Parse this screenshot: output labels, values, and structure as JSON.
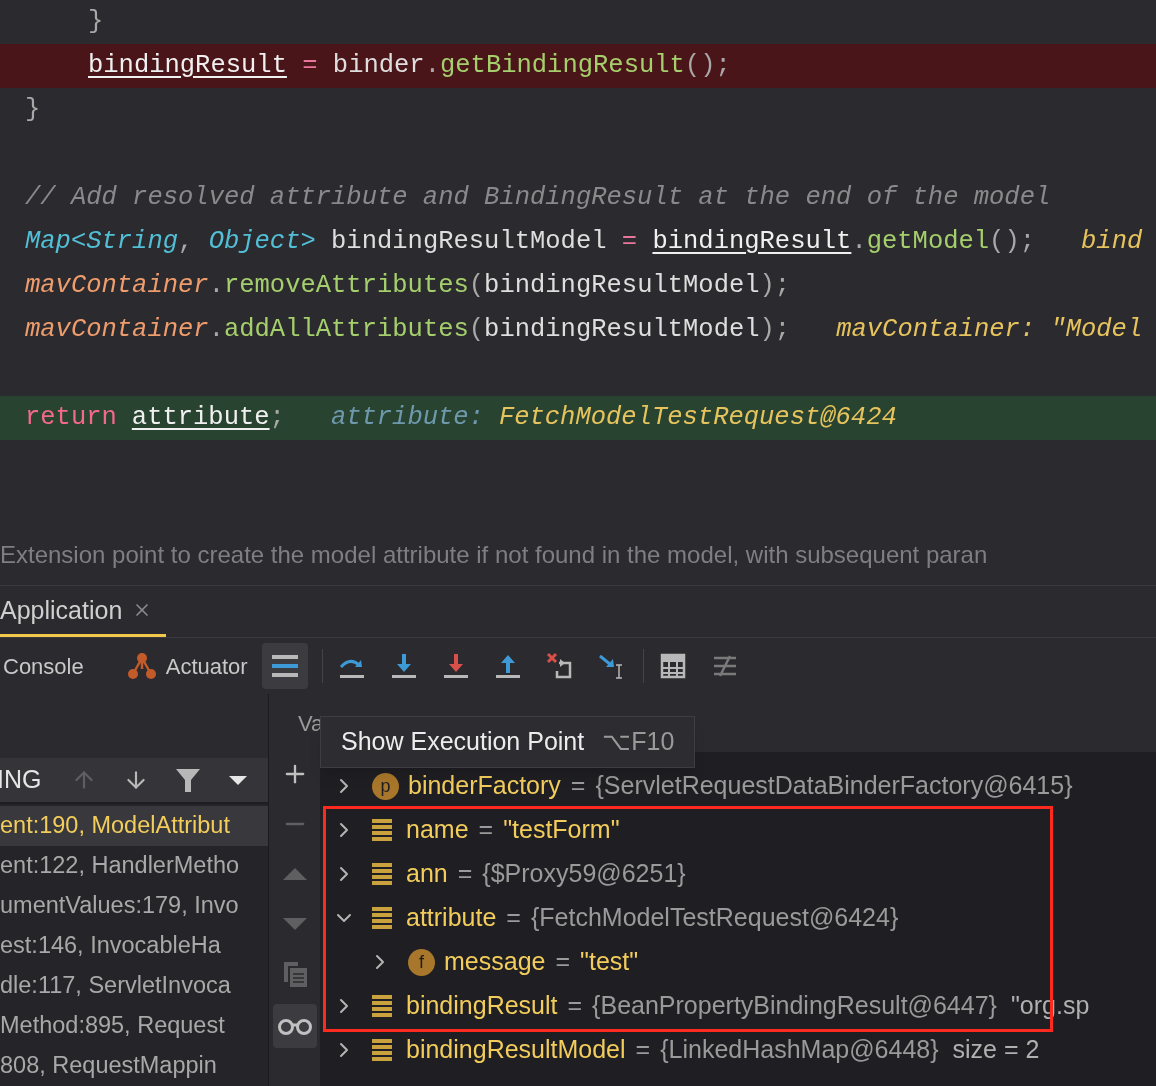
{
  "editor": {
    "lines": [
      {
        "kind": "block",
        "children": [
          {
            "kind": "plain",
            "tokens": [
              {
                "text": "}",
                "kind": "punct"
              }
            ]
          },
          {
            "kind": "error",
            "tokens": [
              {
                "text": "bindingResult",
                "kind": "var"
              },
              {
                "text": " = ",
                "kind": "op"
              },
              {
                "text": "binder",
                "kind": "plain"
              },
              {
                "text": ".",
                "kind": "punct"
              },
              {
                "text": "getBindingResult",
                "kind": "method"
              },
              {
                "text": "();",
                "kind": "punct"
              }
            ]
          }
        ]
      },
      {
        "kind": "plain",
        "tokens": [
          {
            "text": "}",
            "kind": "punct"
          }
        ]
      },
      {
        "kind": "plain"
      },
      {
        "kind": "plain",
        "tokens": [
          {
            "text": "// Add resolved attribute and BindingResult at the end of the model",
            "kind": "comment"
          }
        ]
      },
      {
        "kind": "plain",
        "tokens": [
          {
            "text": "Map<String",
            "kind": "type"
          },
          {
            "text": ", ",
            "kind": "punct"
          },
          {
            "text": "Object>",
            "kind": "type"
          },
          {
            "text": " bindingResultModel ",
            "kind": "plain"
          },
          {
            "text": "= ",
            "kind": "op"
          },
          {
            "text": "bindingResult",
            "kind": "var"
          },
          {
            "text": ".",
            "kind": "punct"
          },
          {
            "text": "getModel",
            "kind": "method"
          },
          {
            "text": "();",
            "kind": "punct"
          }
        ],
        "hint": {
          "value": "bind"
        }
      },
      {
        "kind": "plain",
        "tokens": [
          {
            "text": "mavContainer",
            "kind": "field"
          },
          {
            "text": ".",
            "kind": "punct"
          },
          {
            "text": "removeAttributes",
            "kind": "method"
          },
          {
            "text": "(",
            "kind": "punct"
          },
          {
            "text": "bindingResultModel",
            "kind": "plain"
          },
          {
            "text": ");",
            "kind": "punct"
          }
        ]
      },
      {
        "kind": "plain",
        "tokens": [
          {
            "text": "mavContainer",
            "kind": "field"
          },
          {
            "text": ".",
            "kind": "punct"
          },
          {
            "text": "addAllAttributes",
            "kind": "method"
          },
          {
            "text": "(",
            "kind": "punct"
          },
          {
            "text": "bindingResultModel",
            "kind": "plain"
          },
          {
            "text": ");",
            "kind": "punct"
          }
        ],
        "hint": {
          "value": "mavContainer: \"Model"
        }
      },
      {
        "kind": "plain"
      },
      {
        "kind": "execution",
        "tokens": [
          {
            "text": "return",
            "kind": "keyword"
          },
          {
            "text": "attribute",
            "kind": "var"
          },
          {
            "text": ";",
            "kind": "punct"
          }
        ],
        "hint": {
          "label": "attribute:",
          "value": "FetchModelTestRequest@6424"
        }
      }
    ],
    "doc_comment": "Extension point to create the model attribute if not found in the model, with subsequent paran"
  },
  "tool_window": {
    "tabs": [
      {
        "label": "Application",
        "selected": true
      }
    ],
    "toolbar_tabs": [
      {
        "label": "Console",
        "kind": "console"
      },
      {
        "label": "Actuator",
        "kind": "actuator"
      }
    ],
    "layout_button": {
      "selected": true
    }
  },
  "frames": {
    "header": "ING",
    "items": [
      {
        "text": "ent:190, ModelAttribut",
        "selected": true
      },
      {
        "text": "ent:122, HandlerMetho",
        "selected": false
      },
      {
        "text": "umentValues:179, Invo",
        "selected": false
      },
      {
        "text": "est:146, InvocableHa",
        "selected": false
      },
      {
        "text": "dle:117, ServletInvoca",
        "selected": false
      },
      {
        "text": "Method:895, Request",
        "selected": false
      },
      {
        "text": "808, RequestMappin",
        "selected": false
      }
    ]
  },
  "side_toolbar": {
    "watches": {
      "selected": true
    }
  },
  "variables": {
    "header": "Va",
    "tooltip": {
      "text": "Show Execution Point",
      "shortcut": "⌥F10"
    },
    "items": [
      {
        "kind": "property",
        "badge": "p",
        "name": "binderFactory",
        "operator": "=",
        "value": "{ServletRequestDataBinderFactory@6415}",
        "quoted": false,
        "expanded": false,
        "boxed": false
      },
      {
        "kind": "local",
        "name": "name",
        "operator": "=",
        "value": "\"testForm\"",
        "quoted": true,
        "expanded": false,
        "boxed": true
      },
      {
        "kind": "local",
        "name": "ann",
        "operator": "=",
        "value": "{$Proxy59@6251}",
        "quoted": false,
        "expanded": false,
        "boxed": true
      },
      {
        "kind": "local",
        "name": "attribute",
        "operator": "=",
        "value": "{FetchModelTestRequest@6424}",
        "quoted": false,
        "expanded": true,
        "boxed": true,
        "children": [
          {
            "kind": "property",
            "badge": "f",
            "name": "message",
            "operator": "=",
            "value": "\"test\"",
            "quoted": true,
            "expanded": false,
            "boxed": true
          }
        ]
      },
      {
        "kind": "local",
        "name": "bindingResult",
        "operator": "=",
        "value": "{BeanPropertyBindingResult@6447}",
        "quoted": false,
        "extra": "\"org.sp",
        "expanded": false,
        "boxed": true
      },
      {
        "kind": "local",
        "name": "bindingResultModel",
        "operator": "=",
        "value": "{LinkedHashMap@6448}",
        "quoted": false,
        "extra": "size = 2",
        "expanded": false,
        "boxed": false
      }
    ]
  }
}
